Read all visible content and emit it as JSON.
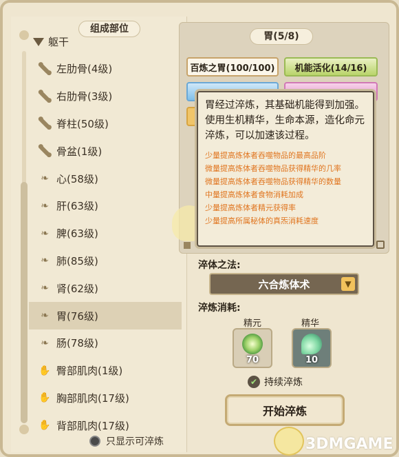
{
  "left_panel": {
    "section_title": "组成部位",
    "group_name": "躯干",
    "parts": [
      {
        "icon": "bone-icon",
        "label": "左肋骨(4级)"
      },
      {
        "icon": "bone-icon",
        "label": "右肋骨(3级)"
      },
      {
        "icon": "bone-icon",
        "label": "脊柱(50级)"
      },
      {
        "icon": "bone-icon",
        "label": "骨盆(1级)"
      },
      {
        "icon": "organ-icon",
        "label": "心(58级)"
      },
      {
        "icon": "organ-icon",
        "label": "肝(63级)"
      },
      {
        "icon": "organ-icon",
        "label": "脾(63级)"
      },
      {
        "icon": "organ-icon",
        "label": "肺(85级)"
      },
      {
        "icon": "organ-icon",
        "label": "肾(62级)"
      },
      {
        "icon": "organ-icon",
        "label": "胃(76级)",
        "selected": true
      },
      {
        "icon": "organ-icon",
        "label": "肠(78级)"
      },
      {
        "icon": "muscle-icon",
        "label": "臀部肌肉(1级)"
      },
      {
        "icon": "muscle-icon",
        "label": "胸部肌肉(17级)"
      },
      {
        "icon": "muscle-icon",
        "label": "背部肌肉(17级)"
      }
    ],
    "filter_label": "只显示可淬炼"
  },
  "right_panel": {
    "organ_title": "胃(5/8)",
    "buttons": {
      "a": "百炼之胃(100/100)",
      "b": "机能活化(14/16)"
    }
  },
  "tooltip": {
    "description": "胃经过淬炼，其基础机能得到加强。使用生机精华，生命本源，造化命元淬炼，可以加速该过程。",
    "effects": [
      "少量提高炼体者吞噬物品的最高品阶",
      "微量提高炼体者吞噬物品获得精华的几率",
      "微量提高炼体者吞噬物品获得精华的数量",
      "中量提高炼体者食物消耗加成",
      "少量提高炼体者精元获得率",
      "少量提高所属秘体的真炁消耗速度"
    ]
  },
  "refine": {
    "method_label": "淬体之法:",
    "method_value": "六合炼体术",
    "cost_label": "淬炼消耗:",
    "resources": [
      {
        "name": "精元",
        "amount": "70"
      },
      {
        "name": "精华",
        "amount": "10"
      }
    ],
    "continue_label": "持续淬炼",
    "start_label": "开始淬炼"
  },
  "watermark": "3DMGAME",
  "colors": {
    "accent_orange": "#e0751f",
    "green_button": "#b9d46a",
    "select_bg": "#756651"
  }
}
